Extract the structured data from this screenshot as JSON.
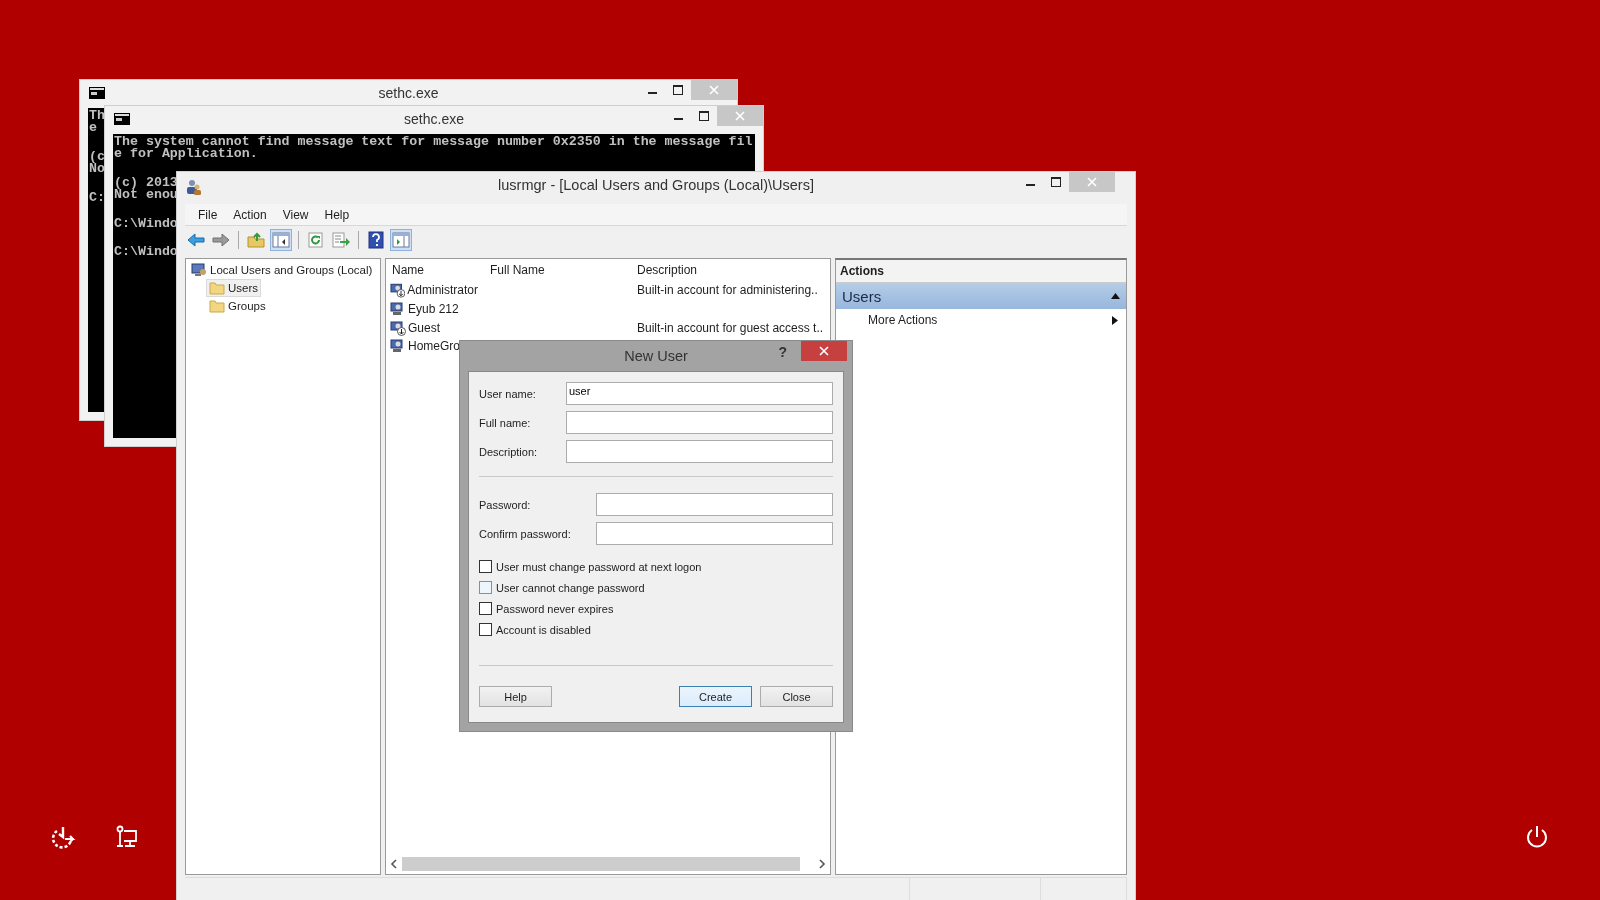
{
  "desktop_icons": [
    {
      "kind": "ease"
    },
    {
      "kind": "network"
    },
    {
      "kind": "power"
    }
  ],
  "console_windows": [
    {
      "title": "sethc.exe",
      "output": [
        [
          "Th",
          "e"
        ],
        [
          "(c",
          "No"
        ],
        [
          "C:"
        ]
      ]
    },
    {
      "title": "sethc.exe",
      "output": [
        [
          "The system cannot find message text for message number 0x2350 in the message fil",
          "e for Application."
        ],
        [
          "(c) 2013",
          "Not enou"
        ],
        [
          "C:\\Windo"
        ],
        [
          "C:\\Windo"
        ]
      ]
    }
  ],
  "mmc": {
    "title": "lusrmgr - [Local Users and Groups (Local)\\Users]",
    "menu": [
      "File",
      "Action",
      "View",
      "Help"
    ],
    "toolbar": [
      {
        "buttons": [
          {
            "kind": "back",
            "pressed": false
          },
          {
            "kind": "forward",
            "pressed": false
          }
        ]
      },
      {
        "buttons": [
          {
            "kind": "up",
            "pressed": false
          },
          {
            "kind": "tree",
            "pressed": true
          }
        ]
      },
      {
        "buttons": [
          {
            "kind": "refresh",
            "pressed": false
          },
          {
            "kind": "export",
            "pressed": false
          }
        ]
      },
      {
        "buttons": [
          {
            "kind": "help",
            "pressed": false
          },
          {
            "kind": "pane",
            "pressed": true
          }
        ]
      }
    ],
    "tree": [
      {
        "label": "Local Users and Groups (Local)",
        "kind": "computer",
        "selected": false,
        "children": [
          {
            "label": "Users",
            "kind": "folder",
            "selected": true
          },
          {
            "label": "Groups",
            "kind": "folder",
            "selected": false
          }
        ]
      }
    ],
    "table": {
      "columns": [
        "Name",
        "Full Name",
        "Description"
      ],
      "rows": [
        {
          "kind": "admin",
          "cells": [
            "Administrator",
            null,
            "Built-in account for administering.."
          ]
        },
        {
          "kind": "user",
          "cells": [
            "Eyub 212",
            null,
            null
          ]
        },
        {
          "kind": "admin",
          "cells": [
            "Guest",
            null,
            "Built-in account for guest access t.."
          ]
        },
        {
          "kind": "user",
          "cells": [
            "HomeGro",
            null,
            null
          ]
        }
      ]
    },
    "actions": {
      "header": "Actions",
      "sections": [
        {
          "title": "Users",
          "expanded": true,
          "items": [
            {
              "label": "More Actions",
              "submenu": true
            }
          ]
        }
      ]
    }
  },
  "dialog": {
    "title": "New User",
    "help_mark": "?",
    "account_fields": [
      {
        "label": "User name:",
        "value": "user"
      },
      {
        "label": "Full name:"
      },
      {
        "label": "Description:"
      }
    ],
    "password_fields": [
      {
        "label": "Password:"
      },
      {
        "label": "Confirm password:"
      }
    ],
    "checkboxes": [
      {
        "label": "User must change password at next logon",
        "checked": false,
        "hover": false
      },
      {
        "label": "User cannot change password",
        "checked": false,
        "hover": true
      },
      {
        "label": "Password never expires",
        "checked": false,
        "hover": false
      },
      {
        "label": "Account is disabled",
        "checked": false,
        "hover": false
      }
    ],
    "buttons": [
      {
        "label": "Help",
        "default": false
      },
      {
        "label": "Create",
        "default": true
      },
      {
        "label": "Close",
        "default": false
      }
    ]
  }
}
